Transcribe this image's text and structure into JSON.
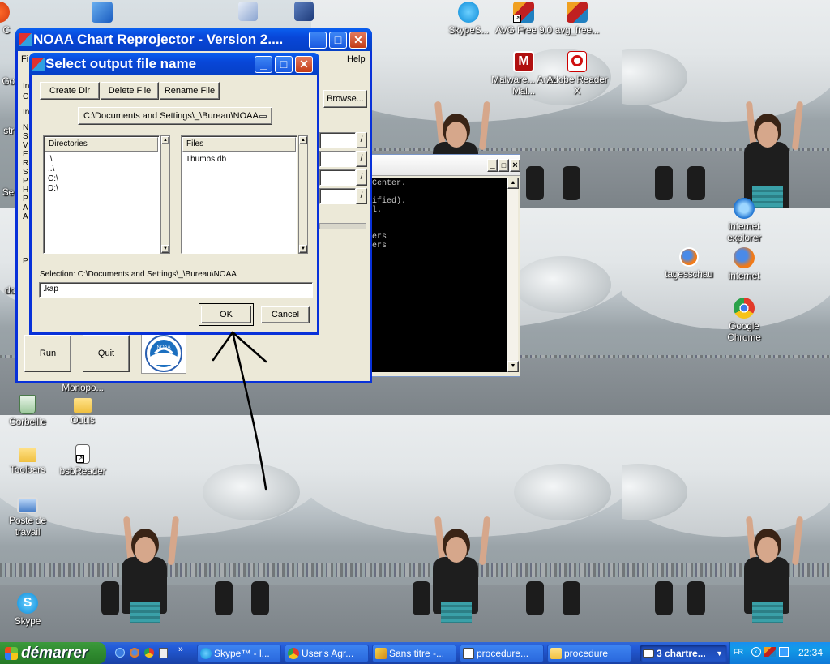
{
  "desktop": {
    "icons": [
      {
        "label": "C",
        "icon": "app-icon"
      },
      {
        "label": "Go",
        "icon": "app-icon"
      },
      {
        "label": "str",
        "icon": "app-icon"
      },
      {
        "label": "Se",
        "icon": "app-icon"
      },
      {
        "label": "do",
        "icon": "app-icon"
      },
      {
        "label": "SkypeS...",
        "icon": "skype-icon"
      },
      {
        "label": "AVG Free 9.0",
        "icon": "avg-icon"
      },
      {
        "label": "avg_free...",
        "icon": "avg-icon"
      },
      {
        "label": "Malware... Anti-Mal...",
        "icon": "malwarebytes-icon"
      },
      {
        "label": "Adobe Reader X",
        "icon": "adobe-reader-icon"
      },
      {
        "label": "internet explorer",
        "icon": "internet-explorer-icon"
      },
      {
        "label": "tagesschau",
        "icon": "firefox-icon"
      },
      {
        "label": "internet",
        "icon": "firefox-icon"
      },
      {
        "label": "Google Chrome",
        "icon": "chrome-icon"
      },
      {
        "label": "Monopo...",
        "icon": "folder-icon"
      },
      {
        "label": "Corbeille",
        "icon": "recycle-bin-icon"
      },
      {
        "label": "Outils",
        "icon": "folder-icon"
      },
      {
        "label": "Toolbars",
        "icon": "folder-icon"
      },
      {
        "label": "bsbReader",
        "icon": "document-icon"
      },
      {
        "label": "Poste de travail",
        "icon": "computer-icon"
      },
      {
        "label": "Skype",
        "icon": "skype-icon"
      }
    ]
  },
  "main_window": {
    "title": "NOAA Chart Reprojector - Version 2....",
    "menu_left": "Fi",
    "menu_help": "Help",
    "browse_label": "Browse...",
    "run_label": "Run",
    "quit_label": "Quit",
    "side_text": [
      "In",
      "C",
      "In",
      "N",
      "S",
      "V",
      "E",
      "R",
      "S",
      "P",
      "H",
      "P",
      "A",
      "A",
      "P"
    ]
  },
  "dialog": {
    "title": "Select output file name",
    "create_dir": "Create Dir",
    "delete_file": "Delete File",
    "rename_file": "Rename File",
    "path_dropdown": "C:\\Documents and Settings\\_\\Bureau\\NOAA",
    "directories_header": "Directories",
    "directories": [
      ".\\",
      "..\\",
      "C:\\",
      "D:\\"
    ],
    "files_header": "Files",
    "files": [
      "Thumbs.db"
    ],
    "selection_label": "Selection: C:\\Documents and Settings\\_\\Bureau\\NOAA",
    "filename_value": ".kap",
    "ok_label": "OK",
    "cancel_label": "Cancel"
  },
  "console_window": {
    "lines": [
      "Center.",
      "",
      "ified).",
      "l.",
      "",
      "",
      "ers",
      "ers"
    ]
  },
  "taskbar": {
    "start_label": "démarrer",
    "tasks": [
      {
        "label": "Skype™ - l...",
        "icon": "skype-icon"
      },
      {
        "label": "User's Agr...",
        "icon": "chrome-icon"
      },
      {
        "label": "Sans titre -...",
        "icon": "paint-icon"
      },
      {
        "label": "procedure...",
        "icon": "document-icon"
      },
      {
        "label": "procedure",
        "icon": "folder-icon"
      },
      {
        "label": "3 chartre...",
        "icon": "window-group-icon"
      }
    ],
    "language": "FR",
    "clock": "22:34"
  }
}
